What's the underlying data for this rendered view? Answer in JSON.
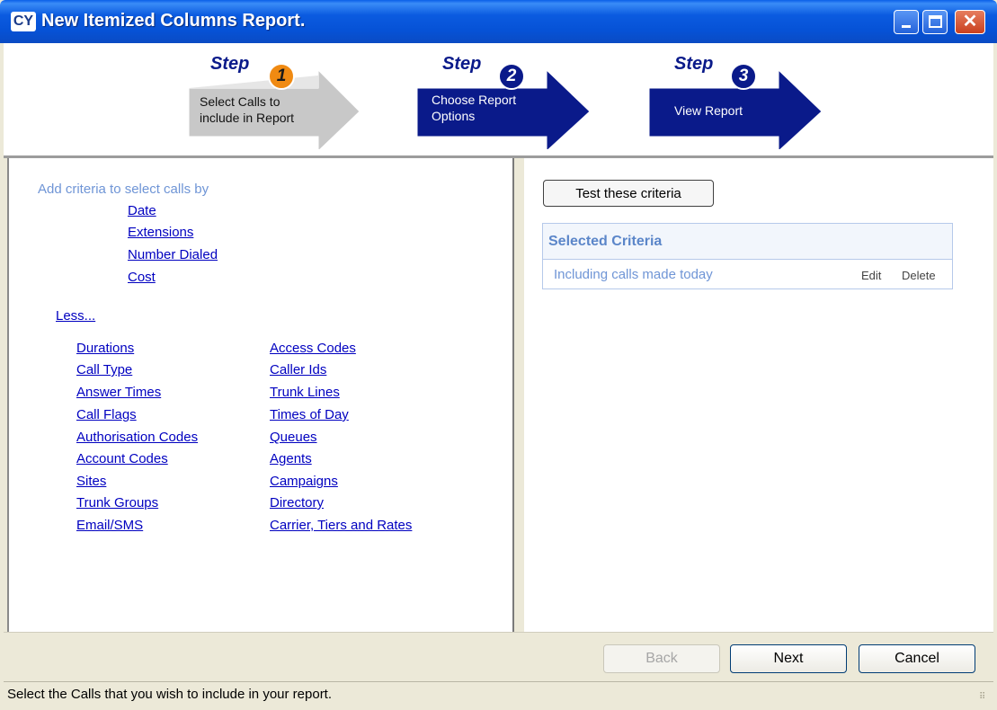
{
  "window": {
    "title": "New Itemized Columns Report.",
    "app_icon_text": "CY",
    "close_glyph": "✕"
  },
  "steps": [
    {
      "word": "Step",
      "number": "1",
      "label_line1": "Select Calls to",
      "label_line2": "include in Report",
      "state": "active"
    },
    {
      "word": "Step",
      "number": "2",
      "label_line1": "Choose Report",
      "label_line2": "Options",
      "state": "inactive"
    },
    {
      "word": "Step",
      "number": "3",
      "label_line1": "View Report",
      "label_line2": "",
      "state": "inactive"
    }
  ],
  "left": {
    "heading": "Add criteria to select calls by",
    "primary_links": [
      "Date",
      "Extensions",
      "Number Dialed",
      "Cost"
    ],
    "less_link": "Less...",
    "column1": [
      "Durations",
      "Call Type",
      "Answer Times",
      "Call Flags",
      "Authorisation Codes",
      "Account Codes",
      "Sites",
      "Trunk Groups",
      "Email/SMS"
    ],
    "column2": [
      "Access Codes",
      "Caller Ids",
      "Trunk Lines",
      "Times of Day",
      "Queues",
      "Agents",
      "Campaigns",
      "Directory",
      "Carrier, Tiers and Rates"
    ]
  },
  "right": {
    "test_button": "Test these criteria",
    "selected_header": "Selected Criteria",
    "criteria_item": "Including calls made today",
    "edit": "Edit",
    "delete": "Delete"
  },
  "footer": {
    "back": "Back",
    "next": "Next",
    "cancel": "Cancel",
    "back_enabled": false
  },
  "status": {
    "text": "Select the Calls that you wish to include in your report."
  },
  "colors": {
    "titlebar": "#0652d6",
    "step_active_arrow": "#c8c8c8",
    "step_inactive_arrow": "#0a1a8a",
    "step_active_badge": "#f08a12",
    "link": "#0000c0",
    "criteria_text": "#6f95d6"
  }
}
